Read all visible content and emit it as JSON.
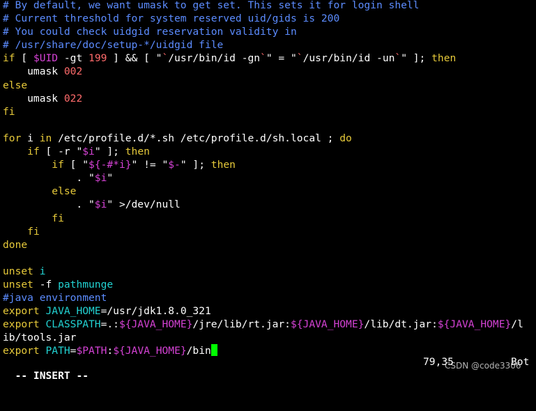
{
  "colors": {
    "background": "#000000",
    "default": "#ffffff",
    "comment": "#5c8cff",
    "keyword": "#e6c93a",
    "variable": "#d442d4",
    "string": "#ff6b6b",
    "identifier": "#22d3d3",
    "cursor": "#00ff00"
  },
  "editor": {
    "lines": [
      [
        [
          "comment",
          "# By default, we want umask to get set. This sets it for login shell"
        ]
      ],
      [
        [
          "comment",
          "# Current threshold for system reserved uid/gids is 200"
        ]
      ],
      [
        [
          "comment",
          "# You could check uidgid reservation validity in"
        ]
      ],
      [
        [
          "comment",
          "# /usr/share/doc/setup-*/uidgid file"
        ]
      ],
      [
        [
          "keyword",
          "if"
        ],
        [
          "default",
          " [ "
        ],
        [
          "variable",
          "$UID"
        ],
        [
          "default",
          " -gt "
        ],
        [
          "string",
          "199"
        ],
        [
          "default",
          " ] && [ \""
        ],
        [
          "string",
          "`"
        ],
        [
          "default",
          "/usr/bin/id -gn"
        ],
        [
          "string",
          "`"
        ],
        [
          "default",
          "\" = \""
        ],
        [
          "string",
          "`"
        ],
        [
          "default",
          "/usr/bin/id -un"
        ],
        [
          "string",
          "`"
        ],
        [
          "default",
          "\" ]; "
        ],
        [
          "keyword",
          "then"
        ]
      ],
      [
        [
          "default",
          "    umask "
        ],
        [
          "string",
          "002"
        ]
      ],
      [
        [
          "keyword",
          "else"
        ]
      ],
      [
        [
          "default",
          "    umask "
        ],
        [
          "string",
          "022"
        ]
      ],
      [
        [
          "keyword",
          "fi"
        ]
      ],
      [
        [
          "default",
          ""
        ]
      ],
      [
        [
          "keyword",
          "for"
        ],
        [
          "default",
          " i "
        ],
        [
          "keyword",
          "in"
        ],
        [
          "default",
          " /etc/profile.d/*.sh /etc/profile.d/sh.local ; "
        ],
        [
          "keyword",
          "do"
        ]
      ],
      [
        [
          "default",
          "    "
        ],
        [
          "keyword",
          "if"
        ],
        [
          "default",
          " [ -r \""
        ],
        [
          "variable",
          "$i"
        ],
        [
          "default",
          "\" ]; "
        ],
        [
          "keyword",
          "then"
        ]
      ],
      [
        [
          "default",
          "        "
        ],
        [
          "keyword",
          "if"
        ],
        [
          "default",
          " [ \""
        ],
        [
          "variable",
          "${-#*i}"
        ],
        [
          "default",
          "\" != \""
        ],
        [
          "variable",
          "$-"
        ],
        [
          "default",
          "\" ]; "
        ],
        [
          "keyword",
          "then"
        ]
      ],
      [
        [
          "default",
          "            . \""
        ],
        [
          "variable",
          "$i"
        ],
        [
          "default",
          "\""
        ]
      ],
      [
        [
          "default",
          "        "
        ],
        [
          "keyword",
          "else"
        ]
      ],
      [
        [
          "default",
          "            . \""
        ],
        [
          "variable",
          "$i"
        ],
        [
          "default",
          "\" >/dev/null"
        ]
      ],
      [
        [
          "default",
          "        "
        ],
        [
          "keyword",
          "fi"
        ]
      ],
      [
        [
          "default",
          "    "
        ],
        [
          "keyword",
          "fi"
        ]
      ],
      [
        [
          "keyword",
          "done"
        ]
      ],
      [
        [
          "default",
          ""
        ]
      ],
      [
        [
          "keyword",
          "unset"
        ],
        [
          "default",
          " "
        ],
        [
          "identifier",
          "i"
        ]
      ],
      [
        [
          "keyword",
          "unset"
        ],
        [
          "default",
          " -f "
        ],
        [
          "identifier",
          "pathmunge"
        ]
      ],
      [
        [
          "comment",
          "#java environment"
        ]
      ],
      [
        [
          "keyword",
          "export"
        ],
        [
          "default",
          " "
        ],
        [
          "identifier",
          "JAVA_HOME"
        ],
        [
          "default",
          "=/usr/jdk1.8.0_321"
        ]
      ],
      [
        [
          "keyword",
          "export"
        ],
        [
          "default",
          " "
        ],
        [
          "identifier",
          "CLASSPATH"
        ],
        [
          "default",
          "=.:"
        ],
        [
          "variable",
          "${JAVA_HOME}"
        ],
        [
          "default",
          "/jre/lib/rt.jar:"
        ],
        [
          "variable",
          "${JAVA_HOME}"
        ],
        [
          "default",
          "/lib/dt.jar:"
        ],
        [
          "variable",
          "${JAVA_HOME}"
        ],
        [
          "default",
          "/l"
        ]
      ],
      [
        [
          "default",
          "ib/tools.jar"
        ]
      ],
      [
        [
          "keyword",
          "export"
        ],
        [
          "default",
          " "
        ],
        [
          "identifier",
          "PATH"
        ],
        [
          "default",
          "="
        ],
        [
          "variable",
          "$PATH"
        ],
        [
          "default",
          ":"
        ],
        [
          "variable",
          "${JAVA_HOME}"
        ],
        [
          "default",
          "/bin"
        ],
        [
          "cursor",
          ""
        ]
      ]
    ]
  },
  "status": {
    "mode": "-- INSERT --",
    "position": "79,35",
    "scroll": "Bot"
  },
  "watermark": "CSDN @code3306"
}
